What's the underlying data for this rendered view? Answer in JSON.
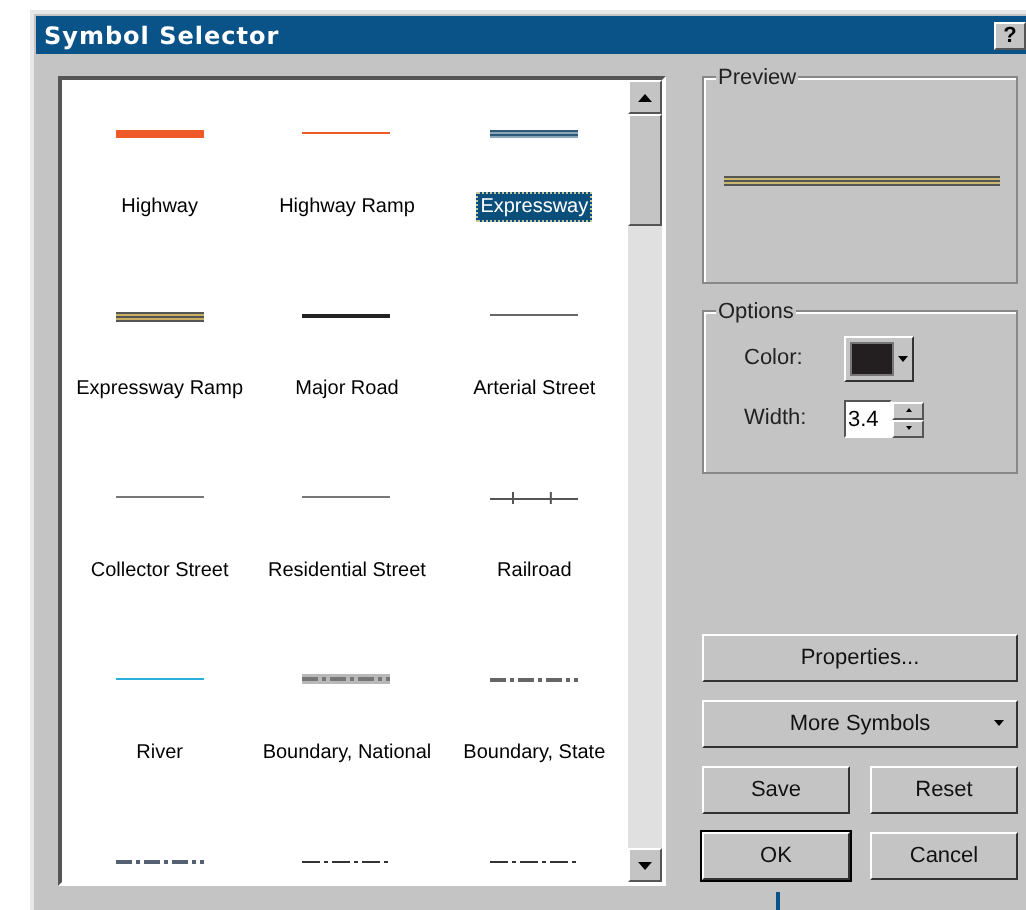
{
  "window": {
    "title": "Symbol Selector",
    "title_buttons": [
      "?"
    ]
  },
  "symbols": [
    {
      "label": "Highway",
      "kind": "thick",
      "color": "#f05a28",
      "selected": false
    },
    {
      "label": "Highway Ramp",
      "kind": "thin",
      "color": "#f05a28",
      "selected": false
    },
    {
      "label": "Expressway",
      "kind": "double",
      "color": "#2c5a78",
      "selected": true
    },
    {
      "label": "Expressway Ramp",
      "kind": "cased",
      "color": "#c8b060",
      "selected": false
    },
    {
      "label": "Major Road",
      "kind": "medium",
      "color": "#222222",
      "selected": false
    },
    {
      "label": "Arterial Street",
      "kind": "thin",
      "color": "#666666",
      "selected": false
    },
    {
      "label": "Collector Street",
      "kind": "thin",
      "color": "#777777",
      "selected": false
    },
    {
      "label": "Residential Street",
      "kind": "thin",
      "color": "#777777",
      "selected": false
    },
    {
      "label": "Railroad",
      "kind": "ticked",
      "color": "#555555",
      "selected": false
    },
    {
      "label": "River",
      "kind": "thin",
      "color": "#2ab0d8",
      "selected": false
    },
    {
      "label": "Boundary, National",
      "kind": "band",
      "color": "#777777",
      "selected": false
    },
    {
      "label": "Boundary, State",
      "kind": "dashed",
      "color": "#666666",
      "selected": false
    },
    {
      "kind": "dashed",
      "color": "#556070"
    },
    {
      "kind": "dashdot",
      "color": "#333333"
    },
    {
      "kind": "dashdot",
      "color": "#333333"
    }
  ],
  "preview": {
    "title": "Preview",
    "kind": "cased",
    "color": "#c8b870"
  },
  "options": {
    "title": "Options",
    "color_label": "Color:",
    "color": "#231f20",
    "width_label": "Width:",
    "width_value": "3.4"
  },
  "buttons": [
    {
      "label": "Properties...",
      "kind": "wide"
    },
    {
      "label": "More Symbols",
      "kind": "dropdown"
    },
    {
      "label": "Save",
      "kind": "half"
    },
    {
      "label": "Reset",
      "kind": "half"
    },
    {
      "label": "OK",
      "kind": "half",
      "default": true
    },
    {
      "label": "Cancel",
      "kind": "half"
    }
  ]
}
